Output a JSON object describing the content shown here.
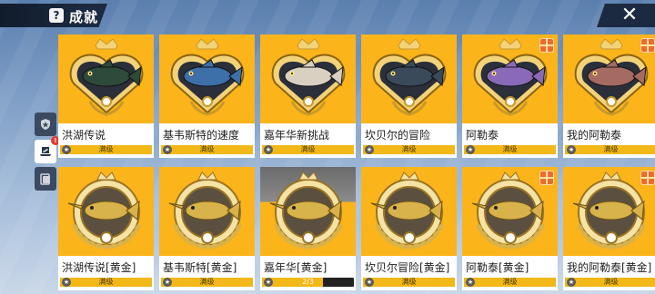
{
  "header": {
    "title": "成就",
    "help_icon": "?",
    "close_icon": "✕"
  },
  "side_tabs": [
    {
      "name": "shield-icon",
      "active": false,
      "badge": ""
    },
    {
      "name": "laptop-icon",
      "active": true,
      "badge": "!"
    },
    {
      "name": "card-icon",
      "active": false,
      "badge": ""
    }
  ],
  "colors": {
    "card_bg": "#fbb41a",
    "progress_fill": "#f2b817",
    "emblem_color_row1": "#c79a2a",
    "emblem_color_row2": "#d8b24a"
  },
  "cards": [
    {
      "name": "洪湖传说",
      "progress_label": "满级",
      "progress": 1.0,
      "gift": false,
      "tier": "color",
      "fish": "#2e4a3a"
    },
    {
      "name": "基韦斯特的速度",
      "progress_label": "满级",
      "progress": 1.0,
      "gift": false,
      "tier": "color",
      "fish": "#3d6fa8"
    },
    {
      "name": "嘉年华新挑战",
      "progress_label": "满级",
      "progress": 1.0,
      "gift": false,
      "tier": "color",
      "fish": "#d9d0c2"
    },
    {
      "name": "坎贝尔的冒险",
      "progress_label": "满级",
      "progress": 1.0,
      "gift": false,
      "tier": "color",
      "fish": "#3a4a5a"
    },
    {
      "name": "阿勒泰",
      "progress_label": "满级",
      "progress": 1.0,
      "gift": true,
      "tier": "color",
      "fish": "#8a6ab8"
    },
    {
      "name": "我的阿勒泰",
      "progress_label": "满级",
      "progress": 1.0,
      "gift": true,
      "tier": "color",
      "fish": "#a56a62"
    },
    {
      "name": "洪湖传说[黄金]",
      "progress_label": "满级",
      "progress": 1.0,
      "gift": false,
      "tier": "gold",
      "fish": "#b08a36"
    },
    {
      "name": "基韦斯特[黄金]",
      "progress_label": "满级",
      "progress": 1.0,
      "gift": false,
      "tier": "gold",
      "fish": "#b08a36"
    },
    {
      "name": "嘉年华[黄金]",
      "progress_label": "2/3",
      "progress": 0.667,
      "gift": false,
      "tier": "gold-dark",
      "fish": "#b08a36"
    },
    {
      "name": "坎贝尔冒险[黄金]",
      "progress_label": "满级",
      "progress": 1.0,
      "gift": false,
      "tier": "gold",
      "fish": "#b08a36"
    },
    {
      "name": "阿勒泰[黄金]",
      "progress_label": "满级",
      "progress": 1.0,
      "gift": true,
      "tier": "gold",
      "fish": "#b08a36"
    },
    {
      "name": "我的阿勒泰[黄金]",
      "progress_label": "满级",
      "progress": 1.0,
      "gift": true,
      "tier": "gold",
      "fish": "#b08a36"
    }
  ]
}
